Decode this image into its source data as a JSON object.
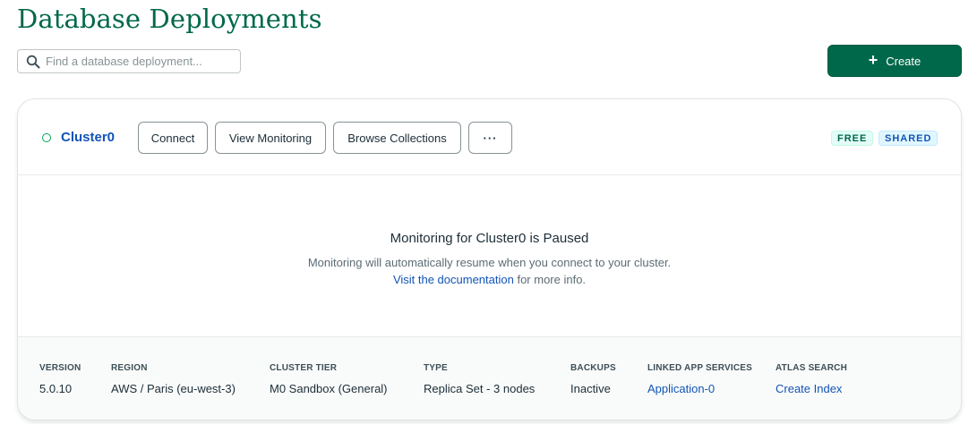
{
  "page": {
    "title": "Database Deployments"
  },
  "search": {
    "placeholder": "Find a database deployment...",
    "value": ""
  },
  "actions": {
    "create_label": "Create"
  },
  "cluster": {
    "name": "Cluster0",
    "buttons": {
      "connect": "Connect",
      "view_monitoring": "View Monitoring",
      "browse_collections": "Browse Collections",
      "more": "···"
    },
    "badges": {
      "free": "FREE",
      "shared": "SHARED"
    },
    "monitoring": {
      "title": "Monitoring for Cluster0 is Paused",
      "description": "Monitoring will automatically resume when you connect to your cluster.",
      "doc_link": "Visit the documentation",
      "doc_suffix": " for more info."
    },
    "details": [
      {
        "label": "VERSION",
        "value": "5.0.10"
      },
      {
        "label": "REGION",
        "value": "AWS / Paris (eu-west-3)"
      },
      {
        "label": "CLUSTER TIER",
        "value": "M0 Sandbox (General)"
      },
      {
        "label": "TYPE",
        "value": "Replica Set - 3 nodes"
      },
      {
        "label": "BACKUPS",
        "value": "Inactive"
      },
      {
        "label": "LINKED APP SERVICES",
        "value": "Application-0"
      },
      {
        "label": "ATLAS SEARCH",
        "value": "Create Index"
      }
    ]
  },
  "colors": {
    "brand_green": "#00684a",
    "link_blue": "#1254b7",
    "status_green": "#00a35c"
  },
  "icons": {
    "search": "search-icon",
    "create": "plus-icon",
    "status": "status-dot-icon",
    "more": "ellipsis-icon"
  }
}
